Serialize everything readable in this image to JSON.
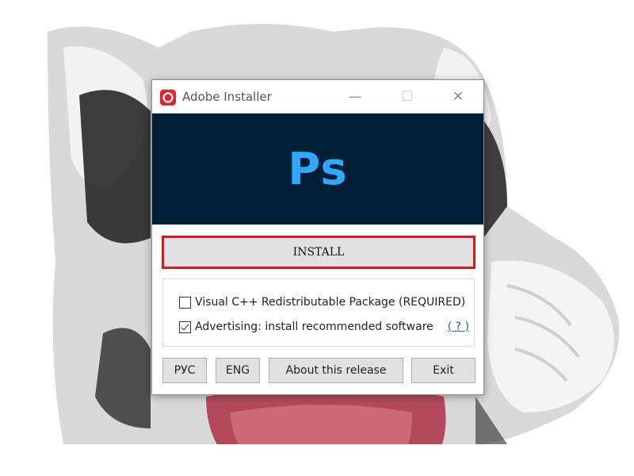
{
  "window": {
    "title": "Adobe Installer",
    "minimize_glyph": "—",
    "maximize_glyph": "☐",
    "close_glyph": "✕",
    "app_icon": "adobe-creative-cloud-icon"
  },
  "banner": {
    "logo_text": "Ps",
    "background_color": "#001e36",
    "logo_color": "#31a8ff"
  },
  "install_button": {
    "label": "INSTALL",
    "highlight_color": "#e3131b"
  },
  "options": [
    {
      "label": "Visual C++ Redistributable Package (REQUIRED)",
      "checked": false
    },
    {
      "label": "Advertising: install recommended software",
      "checked": true,
      "help_link": "( ? )"
    }
  ],
  "footer_buttons": {
    "rus": "РУС",
    "eng": "ENG",
    "about": "About this release",
    "exit": "Exit"
  }
}
